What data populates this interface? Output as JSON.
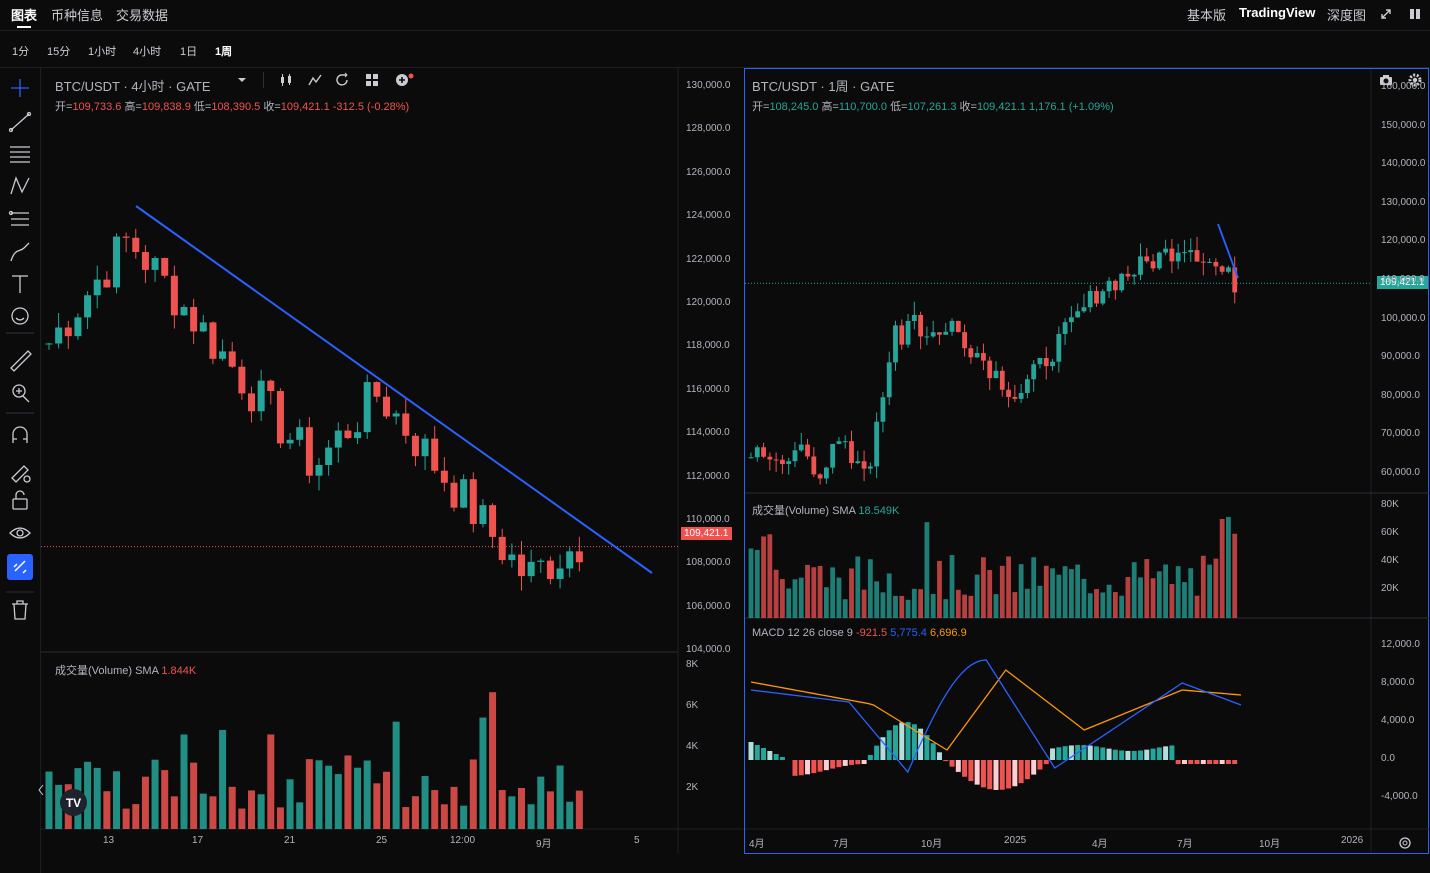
{
  "topbar": {
    "tabs": [
      "图表",
      "币种信息",
      "交易数据"
    ],
    "right": [
      "基本版",
      "TradingView",
      "深度图"
    ]
  },
  "toolbar": {
    "timeframes": [
      "1分",
      "15分",
      "1小时",
      "4小时",
      "1日",
      "1周"
    ],
    "active_timeframe": "1周"
  },
  "left_chart": {
    "title": "BTC/USDT · 4小时 · GATE",
    "ohlc": {
      "o_label": "开=",
      "o": "109,733.6",
      "h_label": "高=",
      "h": "109,838.9",
      "l_label": "低=",
      "l": "108,390.5",
      "c_label": "收=",
      "c": "109,421.1",
      "change": "-312.5 (-0.28%)"
    },
    "price_labels": [
      "130,000.0",
      "128,000.0",
      "126,000.0",
      "124,000.0",
      "122,000.0",
      "120,000.0",
      "118,000.0",
      "116,000.0",
      "114,000.0",
      "112,000.0",
      "110,000.0",
      "108,000.0",
      "106,000.0",
      "104,000.0"
    ],
    "current_price": "109,421.1",
    "volume_title": "成交量(Volume)  SMA",
    "volume_value": "1.844K",
    "volume_labels": [
      "8K",
      "6K",
      "4K",
      "2K"
    ],
    "time_labels": [
      "13",
      "17",
      "21",
      "25",
      "12:00",
      "9月",
      "5"
    ]
  },
  "right_chart": {
    "title": "BTC/USDT · 1周 · GATE",
    "ohlc": {
      "o_label": "开=",
      "o": "108,245.0",
      "h_label": "高=",
      "h": "110,700.0",
      "l_label": "低=",
      "l": "107,261.3",
      "c_label": "收=",
      "c": "109,421.1",
      "change": "1,176.1 (+1.09%)"
    },
    "price_labels": [
      "160,000.0",
      "150,000.0",
      "140,000.0",
      "130,000.0",
      "120,000.0",
      "110,000.0",
      "100,000.0",
      "90,000.0",
      "80,000.0",
      "70,000.0",
      "60,000.0"
    ],
    "current_price": "109,421.1",
    "volume_title": "成交量(Volume)  SMA",
    "volume_value": "18.549K",
    "volume_labels": [
      "80K",
      "60K",
      "40K",
      "20K"
    ],
    "macd_title": "MACD 12 26 close 9",
    "macd_values": {
      "hist": "-921.5",
      "macd": "5,775.4",
      "signal": "6,696.9"
    },
    "macd_labels": [
      "12,000.0",
      "8,000.0",
      "4,000.0",
      "0.0",
      "-4,000.0"
    ],
    "time_labels": [
      "4月",
      "7月",
      "10月",
      "2025",
      "4月",
      "7月",
      "10月",
      "2026"
    ]
  },
  "colors": {
    "up": "#26a69a",
    "down": "#ef5350",
    "trendline": "#2962ff",
    "accent": "#2962ff"
  },
  "icons": [
    "crosshair-icon",
    "trendline-icon",
    "fib-icon",
    "pattern-icon",
    "projection-icon",
    "brush-icon",
    "text-icon",
    "emoji-icon",
    "ruler-icon",
    "zoom-icon",
    "magnet-icon",
    "lock-drawing-icon",
    "lock-icon",
    "eye-icon",
    "link-icon",
    "trash-icon"
  ]
}
